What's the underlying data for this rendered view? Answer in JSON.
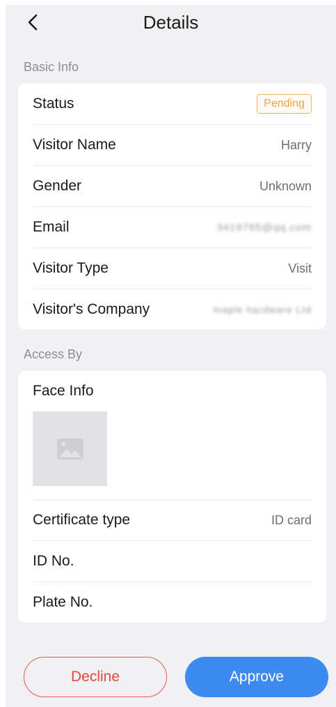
{
  "header": {
    "title": "Details"
  },
  "basic": {
    "section_label": "Basic Info",
    "status": {
      "label": "Status",
      "value": "Pending"
    },
    "name": {
      "label": "Visitor Name",
      "value": "Harry"
    },
    "gender": {
      "label": "Gender",
      "value": "Unknown"
    },
    "email": {
      "label": "Email",
      "value": "3419765@qq.com"
    },
    "type": {
      "label": "Visitor Type",
      "value": "Visit"
    },
    "company": {
      "label": "Visitor's Company",
      "value": "maple hardware Ltd"
    }
  },
  "access": {
    "section_label": "Access By",
    "face": {
      "label": "Face Info"
    },
    "cert": {
      "label": "Certificate type",
      "value": "ID card"
    },
    "id": {
      "label": "ID No.",
      "value": ""
    },
    "plate": {
      "label": "Plate No.",
      "value": ""
    }
  },
  "actions": {
    "decline": "Decline",
    "approve": "Approve"
  },
  "colors": {
    "pending": "#f0a248",
    "decline": "#e2483d",
    "approve": "#3d8af0",
    "background": "#f1f1f4"
  },
  "icons": {
    "back": "chevron-left-icon",
    "face_placeholder": "image-placeholder-icon"
  }
}
